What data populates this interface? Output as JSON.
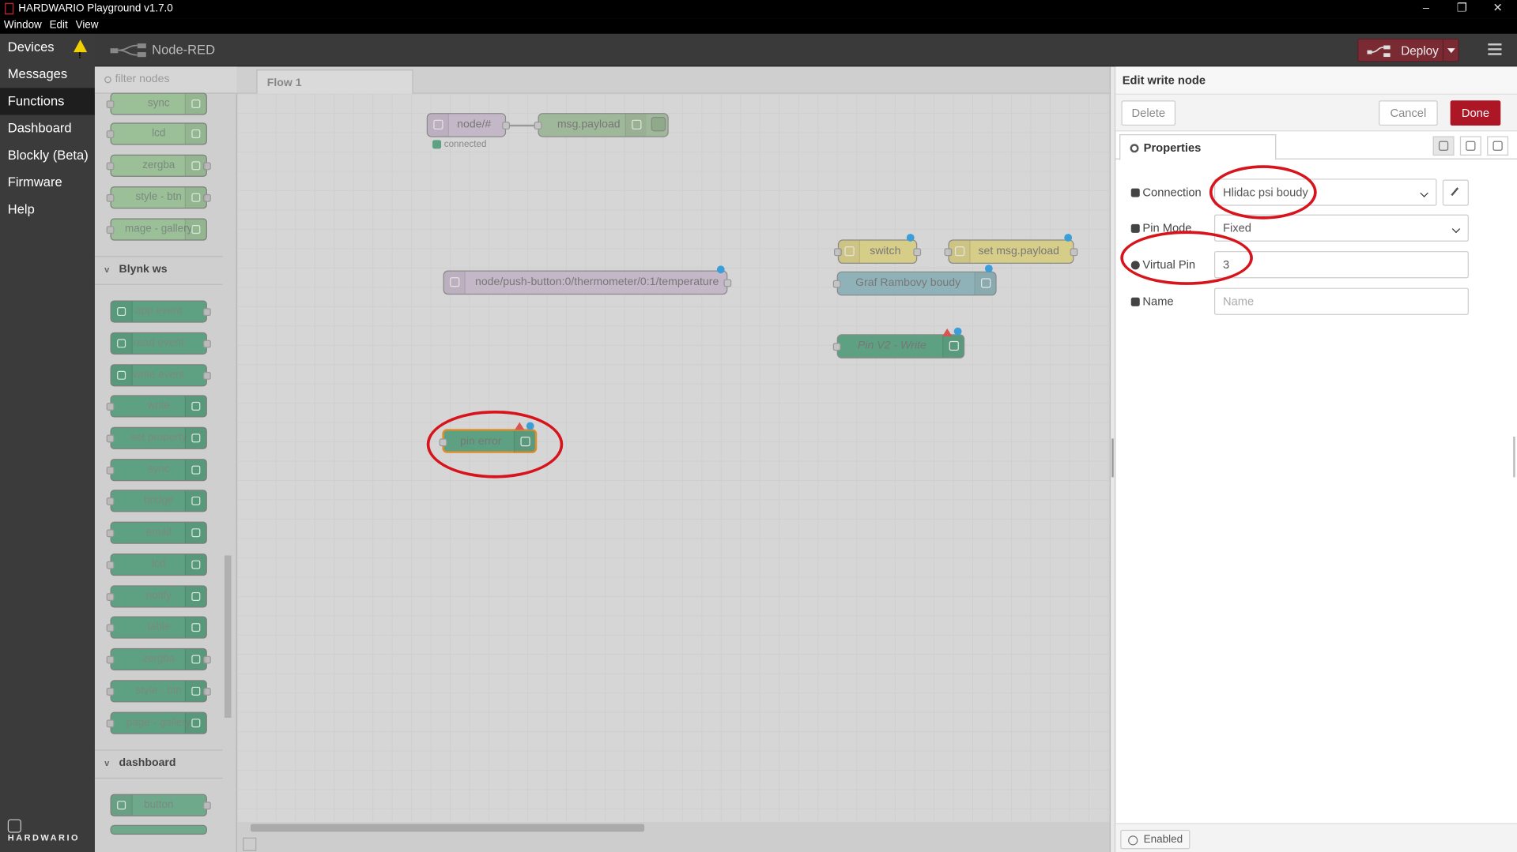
{
  "window": {
    "title": "HARDWARIO Playground v1.7.0",
    "controls": [
      "–",
      "❐",
      "✕"
    ],
    "menu": [
      "Window",
      "Edit",
      "View"
    ]
  },
  "nav": {
    "items": [
      {
        "label": "Devices",
        "warning": true
      },
      {
        "label": "Messages"
      },
      {
        "label": "Functions",
        "active": true
      },
      {
        "label": "Dashboard"
      },
      {
        "label": "Blockly (Beta)"
      },
      {
        "label": "Firmware"
      },
      {
        "label": "Help"
      }
    ],
    "brand": "HARDWARIO"
  },
  "header": {
    "title": "Node-RED",
    "deploy_label": "Deploy"
  },
  "palette": {
    "filter_placeholder": "filter nodes",
    "top_nodes": [
      "sync",
      "lcd",
      "zergba",
      "style - btn",
      "mage - gallery"
    ],
    "categories": [
      "Blynk ws",
      "dashboard"
    ],
    "blynk_nodes": [
      "app event",
      "read event",
      "write event",
      "write",
      "set property",
      "sync",
      "bridge",
      "email",
      "lcd",
      "notify",
      "table",
      "zergba",
      "style - btn",
      "page - gallery"
    ],
    "dashboard_nodes": [
      "button"
    ]
  },
  "workspace": {
    "tab": "Flow 1",
    "nodes": {
      "node_hash": "node/#",
      "node_hash_status": "connected",
      "msg_payload": "msg.payload",
      "temp_topic": "node/push-button:0/thermometer/0:1/temperature",
      "switch": "switch",
      "set_msg_payload": "set msg.payload",
      "graf": "Graf Rambovy boudy",
      "pin_v2": "Pin V2 - Write",
      "pin_error": "pin error"
    }
  },
  "editor": {
    "title": "Edit write node",
    "delete_label": "Delete",
    "cancel_label": "Cancel",
    "done_label": "Done",
    "properties_tab": "Properties",
    "fields": {
      "connection_label": "Connection",
      "connection_value": "Hlidac psi boudy",
      "pin_mode_label": "Pin Mode",
      "pin_mode_value": "Fixed",
      "virtual_pin_label": "Virtual Pin",
      "virtual_pin_value": "3",
      "name_label": "Name",
      "name_placeholder": "Name"
    },
    "enabled_label": "Enabled"
  },
  "colors": {
    "accent": "#ad1625",
    "annotation": "#d7141c",
    "node_green": "#5da182",
    "status_blue": "#3b9ed9"
  }
}
